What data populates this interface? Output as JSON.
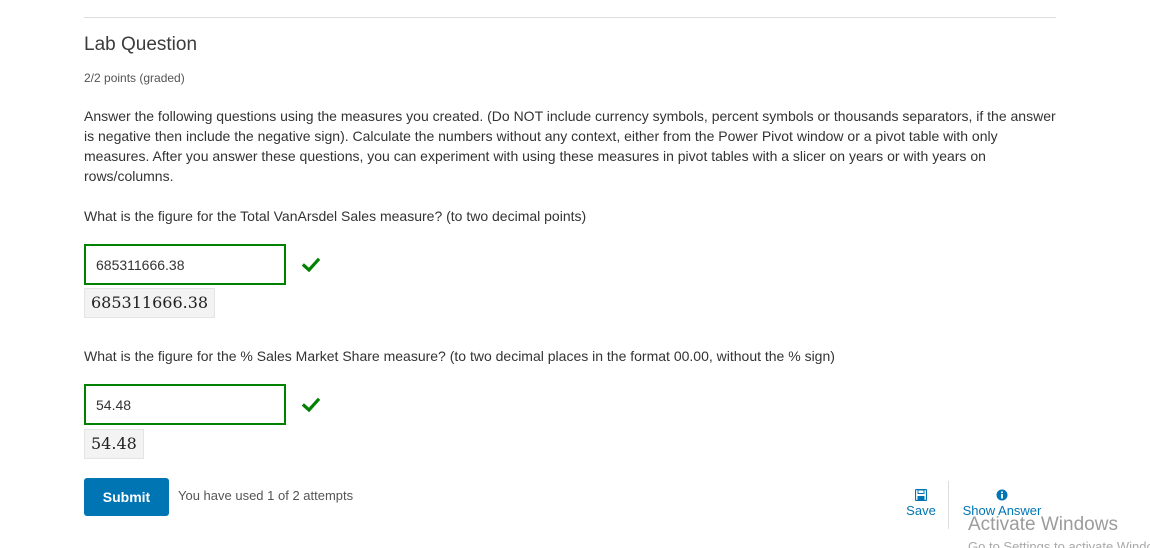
{
  "problem": {
    "title": "Lab Question",
    "points": "2/2 points (graded)",
    "prompt": "Answer the following questions using the measures you created. (Do NOT include currency symbols, percent symbols or thousands separators, if the answer is negative then include the negative sign). Calculate the numbers without any context, either from the Power Pivot window or a pivot table with only measures. After you answer these questions, you can experiment with using these measures in pivot tables with a slicer on years or with years on rows/columns."
  },
  "questions": [
    {
      "text": "What is the figure for the Total VanArsdel Sales measure? (to two decimal points)",
      "answer": "685311666.38",
      "preview": "685311666.38",
      "status": "correct",
      "status_icon": "checkmark-icon"
    },
    {
      "text": "What is the figure for the % Sales Market Share measure? (to two decimal places in the format 00.00, without the % sign)",
      "answer": "54.48",
      "preview": "54.48",
      "status": "correct",
      "status_icon": "checkmark-icon"
    }
  ],
  "actions": {
    "submit_label": "Submit",
    "attempts_text": "You have used 1 of 2 attempts",
    "save_label": "Save",
    "save_icon": "floppy-disk-icon",
    "show_answer_label": "Show Answer",
    "show_answer_icon": "info-circle-icon"
  },
  "watermark": {
    "title": "Activate Windows",
    "subtitle": "Go to Settings to activate Windows."
  },
  "colors": {
    "correct": "#008100",
    "accent": "#0075b4"
  }
}
